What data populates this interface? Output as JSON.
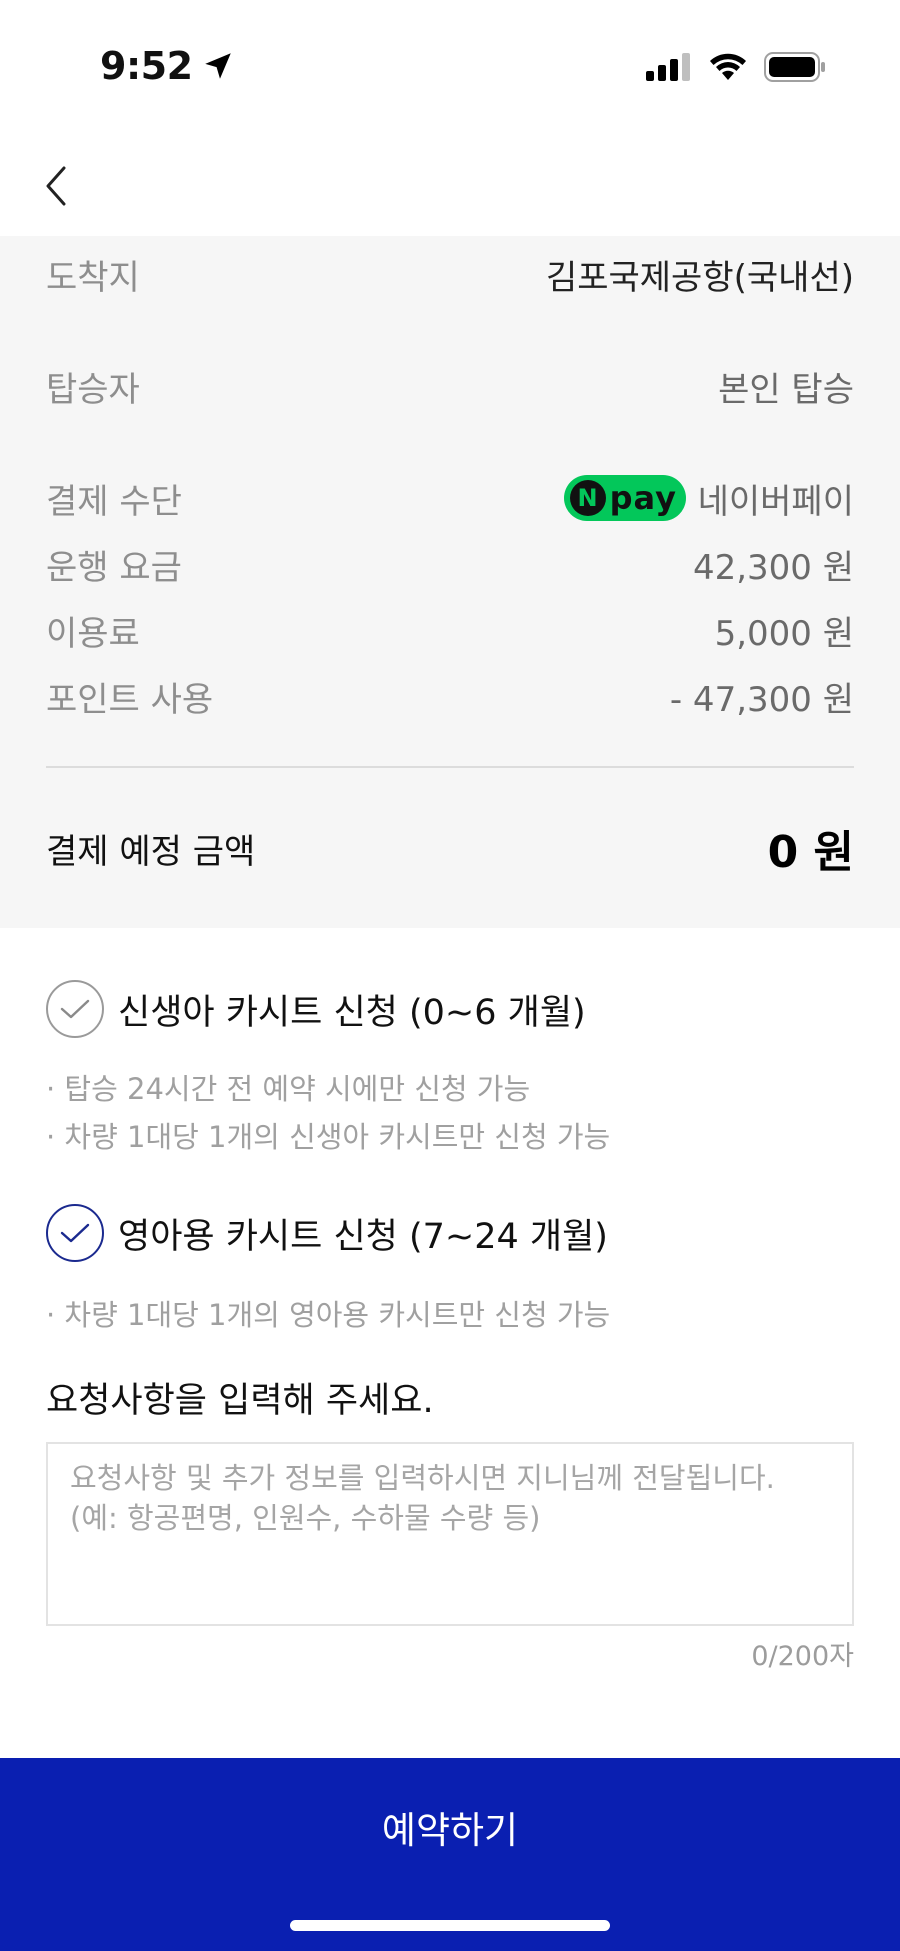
{
  "status_bar": {
    "time": "9:52"
  },
  "summary": {
    "rows": [
      {
        "label": "도착지",
        "value": "김포국제공항(국내선)"
      },
      {
        "label": "탑승자",
        "value": "본인 탑승"
      },
      {
        "label": "결제 수단",
        "value": "네이버페이",
        "badge": "pay"
      },
      {
        "label": "운행 요금",
        "value": "42,300 원"
      },
      {
        "label": "이용료",
        "value": "5,000 원"
      },
      {
        "label": "포인트 사용",
        "value": "- 47,300 원"
      }
    ],
    "total_label": "결제 예정 금액",
    "total_value": "0 원"
  },
  "carseat": {
    "newborn_label": "신생아 카시트 신청 (0~6 개월)",
    "newborn_notes": [
      "· 탑승 24시간 전 예약 시에만 신청 가능",
      "· 차량 1대당 1개의 신생아 카시트만 신청 가능"
    ],
    "infant_label": "영아용 카시트 신청 (7~24 개월)",
    "infant_notes": [
      "· 차량 1대당 1개의 영아용 카시트만 신청 가능"
    ]
  },
  "request": {
    "title": "요청사항을 입력해 주세요.",
    "placeholder": "요청사항 및 추가 정보를 입력하시면 지니님께 전달됩니다.\n(예: 항공편명, 인원수, 수하물 수량 등)",
    "count": "0/200자"
  },
  "colors": {
    "primary": "#0a1fb1",
    "npay": "#03c75a",
    "check_active": "#1b2a8f"
  },
  "reserve_label": "예약하기"
}
